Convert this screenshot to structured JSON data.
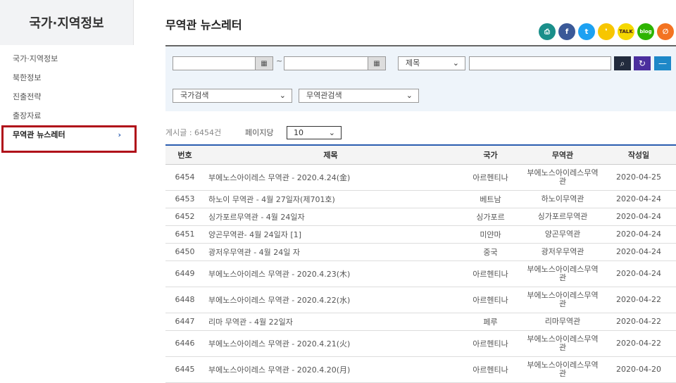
{
  "sidebar": {
    "title": "국가·지역정보",
    "items": [
      {
        "label": "국가·지역정보"
      },
      {
        "label": "북한정보"
      },
      {
        "label": "진출전략"
      },
      {
        "label": "출장자료"
      },
      {
        "label": "무역관 뉴스레터",
        "active": true
      }
    ]
  },
  "page": {
    "title": "무역관 뉴스레터"
  },
  "share_icons": [
    "print-icon",
    "facebook-icon",
    "twitter-icon",
    "kakaostory-icon",
    "kakaotalk-icon",
    "band-icon",
    "blog-icon"
  ],
  "search": {
    "date_separator": "~",
    "field_select": "제목",
    "country_select": "국가검색",
    "office_select": "무역관검색"
  },
  "list": {
    "total": "게시글 : 6454건",
    "per_page_label": "페이지당",
    "per_page_value": "10"
  },
  "table": {
    "headers": [
      "번호",
      "제목",
      "국가",
      "무역관",
      "작성일"
    ],
    "rows": [
      {
        "no": "6454",
        "title": "부에노스아이레스 무역관 - 2020.4.24(金)",
        "country": "아르헨티나",
        "office": "부에노스아이레스무역관",
        "date": "2020-04-25",
        "tall": true
      },
      {
        "no": "6453",
        "title": "하노이 무역관 - 4월 27일자(제701호)",
        "country": "베트남",
        "office": "하노이무역관",
        "date": "2020-04-24",
        "tall": false
      },
      {
        "no": "6452",
        "title": "싱가포르무역관 - 4월 24일자",
        "country": "싱가포르",
        "office": "싱가포르무역관",
        "date": "2020-04-24",
        "tall": false
      },
      {
        "no": "6451",
        "title": "양곤무역관- 4월 24일자 [1]",
        "country": "미얀마",
        "office": "양곤무역관",
        "date": "2020-04-24",
        "tall": false
      },
      {
        "no": "6450",
        "title": "광저우무역관 - 4월 24일 자",
        "country": "중국",
        "office": "광저우무역관",
        "date": "2020-04-24",
        "tall": false
      },
      {
        "no": "6449",
        "title": "부에노스아이레스 무역관 - 2020.4.23(木)",
        "country": "아르헨티나",
        "office": "부에노스아이레스무역관",
        "date": "2020-04-24",
        "tall": true
      },
      {
        "no": "6448",
        "title": "부에노스아이레스 무역관 - 2020.4.22(水)",
        "country": "아르헨티나",
        "office": "부에노스아이레스무역관",
        "date": "2020-04-22",
        "tall": true
      },
      {
        "no": "6447",
        "title": "리마 무역관 - 4월 22일자",
        "country": "페루",
        "office": "리마무역관",
        "date": "2020-04-22",
        "tall": false
      },
      {
        "no": "6446",
        "title": "부에노스아이레스 무역관 - 2020.4.21(火)",
        "country": "아르헨티나",
        "office": "부에노스아이레스무역관",
        "date": "2020-04-22",
        "tall": true
      },
      {
        "no": "6445",
        "title": "부에노스아이레스 무역관 - 2020.4.20(月)",
        "country": "아르헨티나",
        "office": "부에노스아이레스무역관",
        "date": "2020-04-20",
        "tall": true
      }
    ]
  }
}
